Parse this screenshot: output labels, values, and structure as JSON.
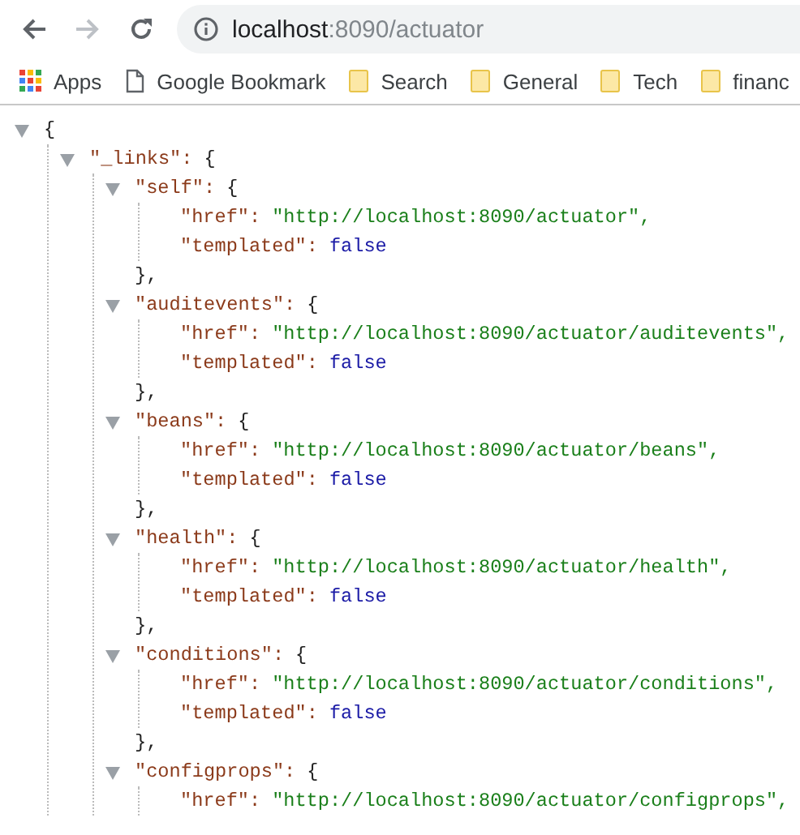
{
  "toolbar": {
    "url_host": "localhost",
    "url_path": ":8090/actuator",
    "forward_disabled": true
  },
  "bookmarks": [
    {
      "kind": "apps",
      "label": "Apps"
    },
    {
      "kind": "page",
      "label": "Google Bookmark"
    },
    {
      "kind": "folder",
      "label": "Search"
    },
    {
      "kind": "folder",
      "label": "General"
    },
    {
      "kind": "folder",
      "label": "Tech"
    },
    {
      "kind": "folder",
      "label": "financ"
    }
  ],
  "json_view": {
    "open": "{",
    "expanded": true,
    "children": [
      {
        "key": "\"_links\":",
        "open": "{",
        "expanded": true,
        "children": [
          {
            "key": "\"self\":",
            "open": "{",
            "expanded": true,
            "close": "},",
            "fields": [
              {
                "key": "\"href\":",
                "value": "\"http://localhost:8090/actuator\",",
                "kind": "string"
              },
              {
                "key": "\"templated\":",
                "value": "false",
                "kind": "boolean"
              }
            ]
          },
          {
            "key": "\"auditevents\":",
            "open": "{",
            "expanded": true,
            "close": "},",
            "fields": [
              {
                "key": "\"href\":",
                "value": "\"http://localhost:8090/actuator/auditevents\",",
                "kind": "string"
              },
              {
                "key": "\"templated\":",
                "value": "false",
                "kind": "boolean"
              }
            ]
          },
          {
            "key": "\"beans\":",
            "open": "{",
            "expanded": true,
            "close": "},",
            "fields": [
              {
                "key": "\"href\":",
                "value": "\"http://localhost:8090/actuator/beans\",",
                "kind": "string"
              },
              {
                "key": "\"templated\":",
                "value": "false",
                "kind": "boolean"
              }
            ]
          },
          {
            "key": "\"health\":",
            "open": "{",
            "expanded": true,
            "close": "},",
            "fields": [
              {
                "key": "\"href\":",
                "value": "\"http://localhost:8090/actuator/health\",",
                "kind": "string"
              },
              {
                "key": "\"templated\":",
                "value": "false",
                "kind": "boolean"
              }
            ]
          },
          {
            "key": "\"conditions\":",
            "open": "{",
            "expanded": true,
            "close": "},",
            "fields": [
              {
                "key": "\"href\":",
                "value": "\"http://localhost:8090/actuator/conditions\",",
                "kind": "string"
              },
              {
                "key": "\"templated\":",
                "value": "false",
                "kind": "boolean"
              }
            ]
          },
          {
            "key": "\"configprops\":",
            "open": "{",
            "expanded": true,
            "fields": [
              {
                "key": "\"href\":",
                "value": "\"http://localhost:8090/actuator/configprops\",",
                "kind": "string"
              }
            ]
          }
        ]
      }
    ]
  }
}
